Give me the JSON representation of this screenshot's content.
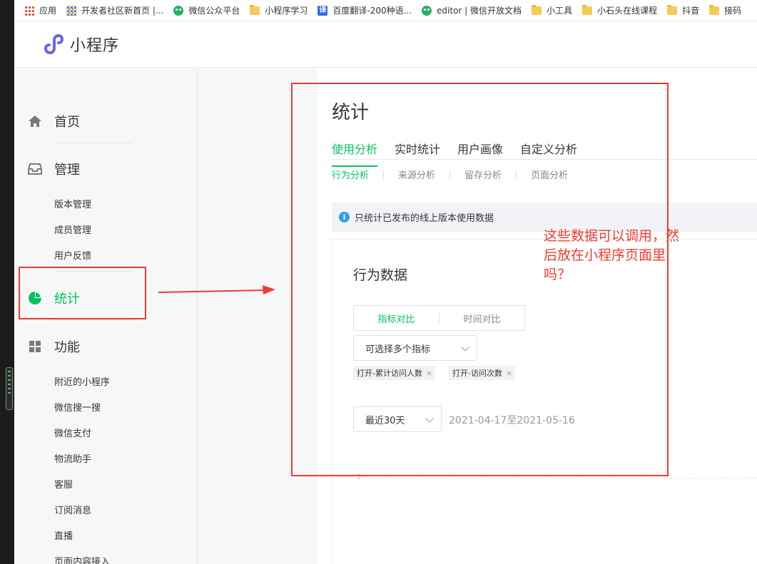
{
  "bookmarks": [
    {
      "label": "应用",
      "icon": "apps-grid-icon"
    },
    {
      "label": "开发者社区新首页 |...",
      "icon": "dev-community-icon"
    },
    {
      "label": "微信公众平台",
      "icon": "wechat-icon"
    },
    {
      "label": "小程序学习",
      "icon": "folder-icon"
    },
    {
      "label": "百度翻译-200种语...",
      "icon": "fanyi-icon",
      "glyph": "译"
    },
    {
      "label": "editor | 微信开放文档",
      "icon": "wechat-icon"
    },
    {
      "label": "小工具",
      "icon": "folder-icon"
    },
    {
      "label": "小石头在线课程",
      "icon": "folder-icon"
    },
    {
      "label": "抖音",
      "icon": "folder-icon"
    },
    {
      "label": "接码",
      "icon": "folder-icon"
    }
  ],
  "header": {
    "title": "小程序"
  },
  "sidebar": {
    "home": "首页",
    "manage": "管理",
    "manage_items": [
      "版本管理",
      "成员管理",
      "用户反馈"
    ],
    "stats": "统计",
    "features": "功能",
    "feature_items": [
      "附近的小程序",
      "微信搜一搜",
      "微信支付",
      "物流助手",
      "客服",
      "订阅消息",
      "直播",
      "页面内容接入"
    ]
  },
  "main": {
    "title": "统计",
    "tabs": [
      "使用分析",
      "实时统计",
      "用户画像",
      "自定义分析"
    ],
    "subtabs": [
      "行为分析",
      "来源分析",
      "留存分析",
      "页面分析"
    ],
    "notice": "只统计已发布的线上版本使用数据",
    "notice_icon": "i"
  },
  "behavior": {
    "title": "行为数据",
    "segments": [
      "指标对比",
      "时间对比"
    ],
    "metric_select": "可选择多个指标",
    "chips": [
      "打开-累计访问人数",
      "打开-访问次数"
    ],
    "chip_close": "×",
    "period_select": "最近30天",
    "date_range": "2021-04-17至2021-05-16",
    "axis_tick": "2"
  },
  "annotation": {
    "text": "这些数据可以调用，然后放在小程序页面里吗？",
    "color": "#f03a2f"
  },
  "colors": {
    "accent": "#07c160",
    "annotation": "#f03a2f"
  }
}
